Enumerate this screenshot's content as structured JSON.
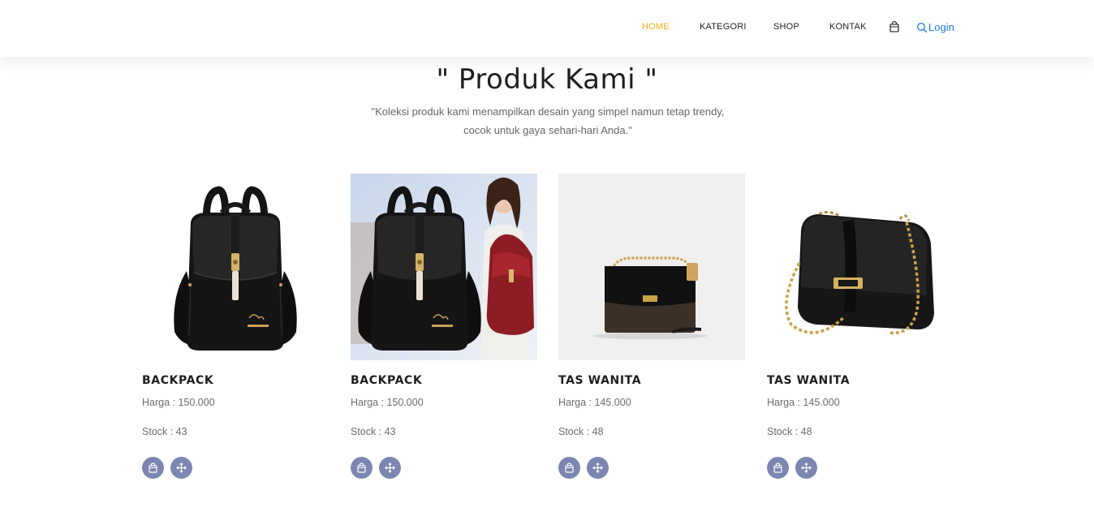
{
  "nav": {
    "items": [
      {
        "label": "HOME",
        "active": true
      },
      {
        "label": "KATEGORI",
        "active": false
      },
      {
        "label": "SHOP",
        "active": false
      },
      {
        "label": "KONTAK",
        "active": false
      }
    ],
    "login_label": "Login",
    "cart_icon": "shopping-bag-icon",
    "search_icon": "search-icon"
  },
  "colors": {
    "accent": "#f5b014",
    "link": "#1f7ae0",
    "button": "#7c86b1"
  },
  "section": {
    "title": "\" Produk Kami \"",
    "description": "\"Koleksi produk kami menampilkan desain yang simpel namun tetap trendy, cocok untuk gaya sehari-hari Anda.\""
  },
  "products": [
    {
      "name": "BACKPACK",
      "price": "Harga : 150.000",
      "stock": "Stock : 43",
      "image": "black-backpack"
    },
    {
      "name": "BACKPACK",
      "price": "Harga : 150.000",
      "stock": "Stock : 43",
      "image": "backpack-with-model"
    },
    {
      "name": "TAS WANITA",
      "price": "Harga : 145.000",
      "stock": "Stock : 48",
      "image": "small-chain-bag"
    },
    {
      "name": "TAS WANITA",
      "price": "Harga : 145.000",
      "stock": "Stock : 48",
      "image": "chain-shoulder-bag"
    }
  ]
}
